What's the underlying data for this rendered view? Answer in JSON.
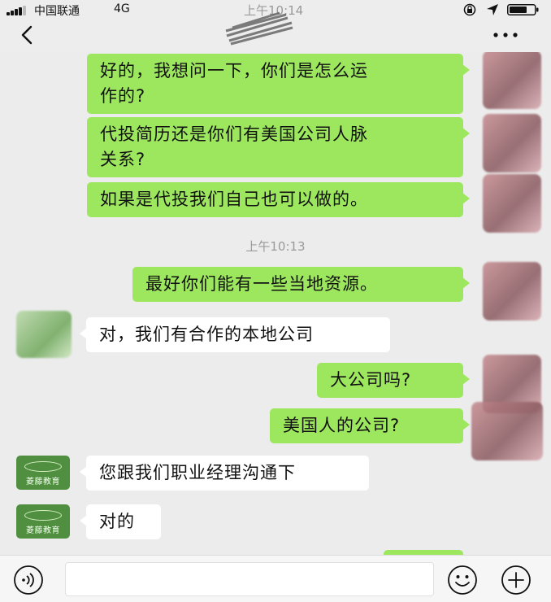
{
  "status_bar": {
    "carrier": "中国联通",
    "network": "4G",
    "time": "上午10:14"
  },
  "navbar": {
    "back_icon": "chevron-left-icon",
    "more_icon": "ellipsis-icon"
  },
  "timestamp": "上午10:13",
  "messages": [
    {
      "side": "right",
      "lines": [
        "好的，我想问一下，你们是怎么运",
        "作的?"
      ]
    },
    {
      "side": "right",
      "lines": [
        "代投简历还是你们有美国公司人脉",
        "关系?"
      ]
    },
    {
      "side": "right",
      "lines": [
        "如果是代投我们自己也可以做的。"
      ]
    },
    {
      "side": "right",
      "lines": [
        "最好你们能有一些当地资源。"
      ]
    },
    {
      "side": "left",
      "lines": [
        "对，我们有合作的本地公司"
      ]
    },
    {
      "side": "right",
      "lines": [
        "大公司吗?"
      ]
    },
    {
      "side": "right",
      "lines": [
        "美国人的公司?"
      ]
    },
    {
      "side": "left",
      "lines": [
        "您跟我们职业经理沟通下"
      ]
    },
    {
      "side": "left",
      "lines": [
        "对的"
      ]
    }
  ],
  "contact_avatar": {
    "brand": "Vanlinx",
    "label": "菱藤教育",
    "color": "#4f8f3f"
  },
  "input_bar": {
    "placeholder": "",
    "voice_icon": "voice-icon",
    "emoji_icon": "emoji-icon",
    "plus_icon": "plus-icon"
  },
  "colors": {
    "right_bubble": "#9de75f",
    "left_bubble": "#ffffff",
    "background": "#ececec"
  }
}
